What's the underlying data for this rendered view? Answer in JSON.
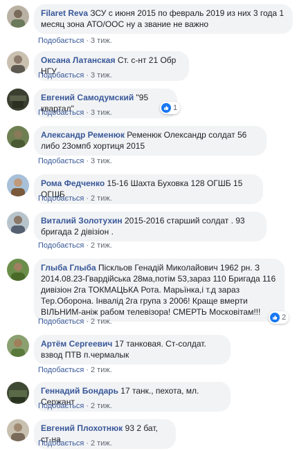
{
  "comments": [
    {
      "author": "Filaret Reva",
      "text": "ЗСУ с июня 2015 по февраль 2019 из них 3 года 1 месяц зона АТО/ООС ну а звание не важно",
      "reply": "Подобається",
      "time": "3 тиж.",
      "avatar_color": "#7a8a6a"
    },
    {
      "author": "Оксана Латанская",
      "text": "Ст. с-нт 21 Обр НГУ",
      "reply": "Подобається",
      "time": "3 тиж.",
      "avatar_color": "#8c7a6a"
    },
    {
      "author": "Евгений Самодумский",
      "text": "\"95 квартал\"",
      "reply": "Подобається",
      "time": "3 тиж.",
      "avatar_color": "#4a4f3e",
      "reactions": "1"
    },
    {
      "author": "Александр Ременюк",
      "text": "Ременюк Олександр солдат 56 либо 23омпб хортиця 2015",
      "reply": "Подобається",
      "time": "3 тиж.",
      "avatar_color": "#6e7f52"
    },
    {
      "author": "Рома Федченко",
      "text": "15-16 Шахта Буховка 128 ОГШБ 15 ОГШБ",
      "reply": "Подобається",
      "time": "2 тиж.",
      "avatar_color": "#9a7b5a"
    },
    {
      "author": "Виталий Золотухин",
      "text": "2015-2016 старший солдат . 93 бригада 2 дівізіон .",
      "reply": "Подобається",
      "time": "2 тиж.",
      "avatar_color": "#8893a0"
    },
    {
      "author": "Глыба Глыба",
      "text": "Піскльов Генадій Миколайович 1962 рн. З 2014.08.23-Гвардійська 28ма,потім 53,зараз 110 Бригада 116 дивізіон 2га ТОКМАЦЬКА Рота. Марьїнка,і т.д зараз Тер.Оборона. Інвалід 2га група з 2006! Краще вмерти ВІЛЬНИМ-аніж рабом телевізора! СМЕРТЬ Московітам!!!",
      "reply": "Подобається",
      "time": "2 тиж.",
      "avatar_color": "#6b8f4a",
      "reactions": "2"
    },
    {
      "author": "Артём Сергеевич",
      "text": "17 танковая. Ст-солдат. взвод ПТВ п.чермалык",
      "reply": "Подобається",
      "time": "2 тиж.",
      "avatar_color": "#5a7a3c"
    },
    {
      "author": "Геннадий Бондарь",
      "text": "17 танк., пехота, мл. Сержант",
      "reply": "Подобається",
      "time": "2 тиж.",
      "avatar_color": "#3f4a35"
    },
    {
      "author": "Евгений Плохотнюк",
      "text": "93 2 бат, ст-на",
      "reply": "Подобається",
      "time": "2 тиж.",
      "avatar_color": "#9a8f7a"
    }
  ]
}
